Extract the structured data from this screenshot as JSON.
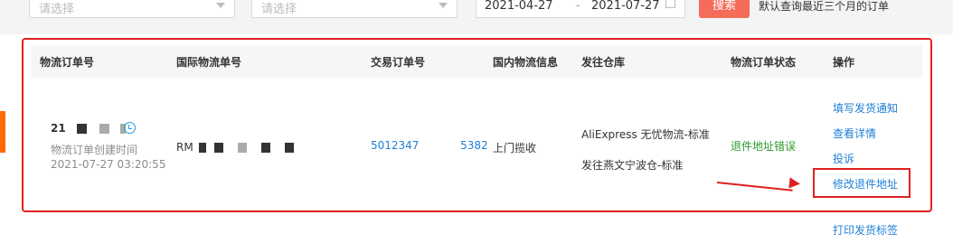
{
  "filters": {
    "select1_placeholder": "请选择",
    "select2_placeholder": "请选择",
    "date_start": "2021-04-27",
    "date_separator": "-",
    "date_end": "2021-07-27",
    "search_label": "搜索",
    "hint": "默认查询最近三个月的订单"
  },
  "table": {
    "headers": [
      "物流订单号",
      "国际物流单号",
      "交易订单号",
      "国内物流信息",
      "发往仓库",
      "物流订单状态",
      "操作"
    ],
    "row": {
      "order_prefix": "21",
      "created_label": "物流订单创建时间",
      "created_time": "2021-07-27 03:20:55",
      "intl_prefix": "RM",
      "trade_start": "5012347",
      "trade_end": "5382",
      "domestic_info": "上门揽收",
      "warehouse_line1": "AliExpress 无忧物流-标准",
      "warehouse_line2": "发往燕文宁波仓-标准",
      "status": "退件地址错误",
      "actions": [
        "填写发货通知",
        "查看详情",
        "投诉",
        "修改退件地址",
        "打印发货标签"
      ]
    }
  },
  "colors": {
    "accent": "#f56c5b",
    "link": "#1e7fd6",
    "status_error": "#2e9a2e",
    "annotation": "#e02020"
  }
}
